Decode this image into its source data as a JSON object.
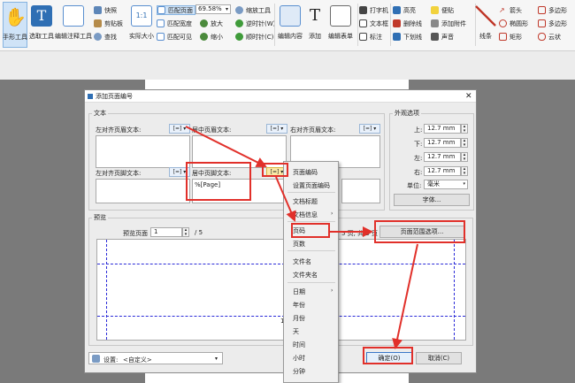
{
  "ribbon": {
    "hand_tool": "手形工具",
    "select_tool": "选取工具",
    "annotate_tool": "编辑注释工具",
    "snapshot": "快照",
    "clipboard": "剪贴板",
    "find": "查找",
    "actual_size": "实际大小",
    "fit_page": "匹配页面",
    "fit_width": "匹配宽度",
    "fit_visible": "匹配可见",
    "zoom_value": "69.58%",
    "zoom_in": "放大",
    "zoom_out": "缩小",
    "zoom_tool": "缩放工具",
    "rotate_ccw": "逆时针(W)",
    "rotate_cw": "顺时针(C)",
    "edit_content": "编辑内容",
    "add": "添加",
    "edit_form": "编辑表单",
    "typewriter": "打字机",
    "textbox": "文本框",
    "callout": "标注",
    "highlight": "高亮",
    "strikeout": "删除线",
    "underline": "下划线",
    "sticky_note": "便贴",
    "attach_file": "添加附件",
    "sound": "声音",
    "line": "线条",
    "arrow": "箭头",
    "ellipse": "椭圆形",
    "rectangle": "矩形",
    "polygon": "多边形",
    "polyline": "多边形",
    "cloud": "云状"
  },
  "dialog": {
    "title": "添加页面编号",
    "text_group": "文本",
    "left_header": "左对齐页眉文本:",
    "center_header": "居中页眉文本:",
    "right_header": "右对齐页眉文本:",
    "left_footer": "左对齐页脚文本:",
    "center_footer": "居中页脚文本:",
    "center_footer_value": "%[Page]",
    "margins_group": "外观选项",
    "top_label": "上:",
    "top_value": "12.7 mm",
    "bottom_label": "下:",
    "bottom_value": "12.7 mm",
    "left_label": "左:",
    "left_value": "12.7 mm",
    "right_label": "右:",
    "right_value": "12.7 mm",
    "unit_label": "单位:",
    "unit_value": "毫米",
    "font_button": "字体...",
    "preview_group": "预览",
    "preview_page_label": "预览页面",
    "preview_page_value": "1",
    "preview_total": "/ 5",
    "preview_info": "5 页, 共 5 页",
    "page_range_button": "页面范围选项...",
    "preview_number": "1",
    "settings_label": "设置:",
    "settings_value": "<自定义>",
    "ok_button": "确定(O)",
    "cancel_button": "取消(C)"
  },
  "menu": {
    "insert_page_number": "页面编码",
    "set_page_number": "设置页面编码",
    "doc_title": "文档标题",
    "doc_info": "文档信息",
    "page_num": "页码",
    "page_count": "页数",
    "file_name": "文件名",
    "folder_name": "文件夹名",
    "date": "日期",
    "year": "年份",
    "month": "月份",
    "day": "天",
    "time": "时间",
    "hour": "小时",
    "minute": "分钟"
  },
  "colors": {
    "annotation_red": "#e1302a",
    "preview_dash": "#2a2ad8"
  }
}
